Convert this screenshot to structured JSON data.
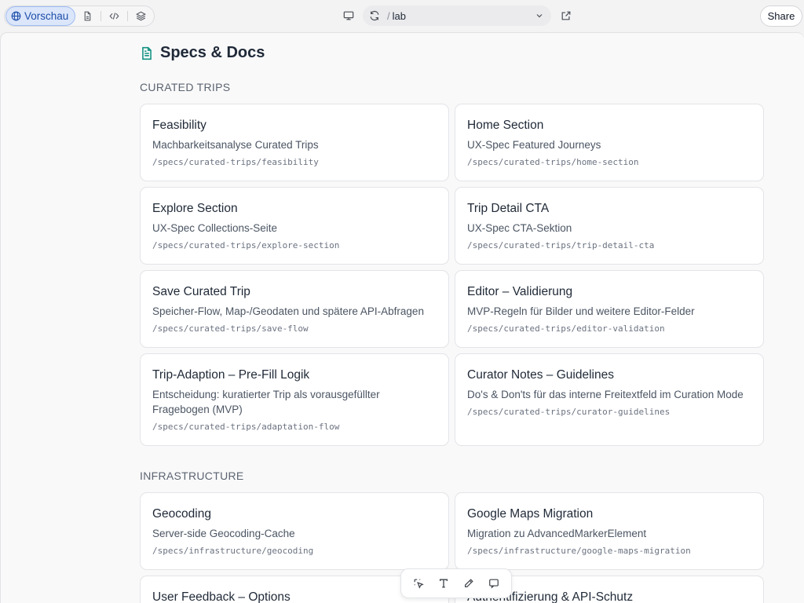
{
  "toolbar": {
    "preview_label": "Vorschau",
    "url_prefix": "/",
    "url_path": "lab",
    "share_label": "Share"
  },
  "page": {
    "title": "Specs & Docs",
    "icon": "document-icon"
  },
  "sections": [
    {
      "title": "CURATED TRIPS",
      "cards": [
        {
          "title": "Feasibility",
          "desc": "Machbarkeitsanalyse Curated Trips",
          "path": "/specs/curated-trips/feasibility"
        },
        {
          "title": "Home Section",
          "desc": "UX-Spec Featured Journeys",
          "path": "/specs/curated-trips/home-section"
        },
        {
          "title": "Explore Section",
          "desc": "UX-Spec Collections-Seite",
          "path": "/specs/curated-trips/explore-section"
        },
        {
          "title": "Trip Detail CTA",
          "desc": "UX-Spec CTA-Sektion",
          "path": "/specs/curated-trips/trip-detail-cta"
        },
        {
          "title": "Save Curated Trip",
          "desc": "Speicher-Flow, Map-/Geodaten und spätere API-Abfragen",
          "path": "/specs/curated-trips/save-flow"
        },
        {
          "title": "Editor – Validierung",
          "desc": "MVP-Regeln für Bilder und weitere Editor-Felder",
          "path": "/specs/curated-trips/editor-validation"
        },
        {
          "title": "Trip-Adaption – Pre-Fill Logik",
          "desc": "Entscheidung: kuratierter Trip als vorausgefüllter Fragebogen (MVP)",
          "path": "/specs/curated-trips/adaptation-flow"
        },
        {
          "title": "Curator Notes – Guidelines",
          "desc": "Do's & Don'ts für das interne Freitextfeld im Curation Mode",
          "path": "/specs/curated-trips/curator-guidelines"
        }
      ]
    },
    {
      "title": "INFRASTRUCTURE",
      "cards": [
        {
          "title": "Geocoding",
          "desc": "Server-side Geocoding-Cache",
          "path": "/specs/infrastructure/geocoding"
        },
        {
          "title": "Google Maps Migration",
          "desc": "Migration zu AdvancedMarkerElement",
          "path": "/specs/infrastructure/google-maps-migration"
        },
        {
          "title": "User Feedback – Options",
          "desc": "",
          "path": ""
        },
        {
          "title": "Authentifizierung & API-Schutz",
          "desc": "",
          "path": ""
        }
      ]
    }
  ],
  "dock": [
    "select-icon",
    "text-icon",
    "pencil-icon",
    "comment-icon"
  ]
}
